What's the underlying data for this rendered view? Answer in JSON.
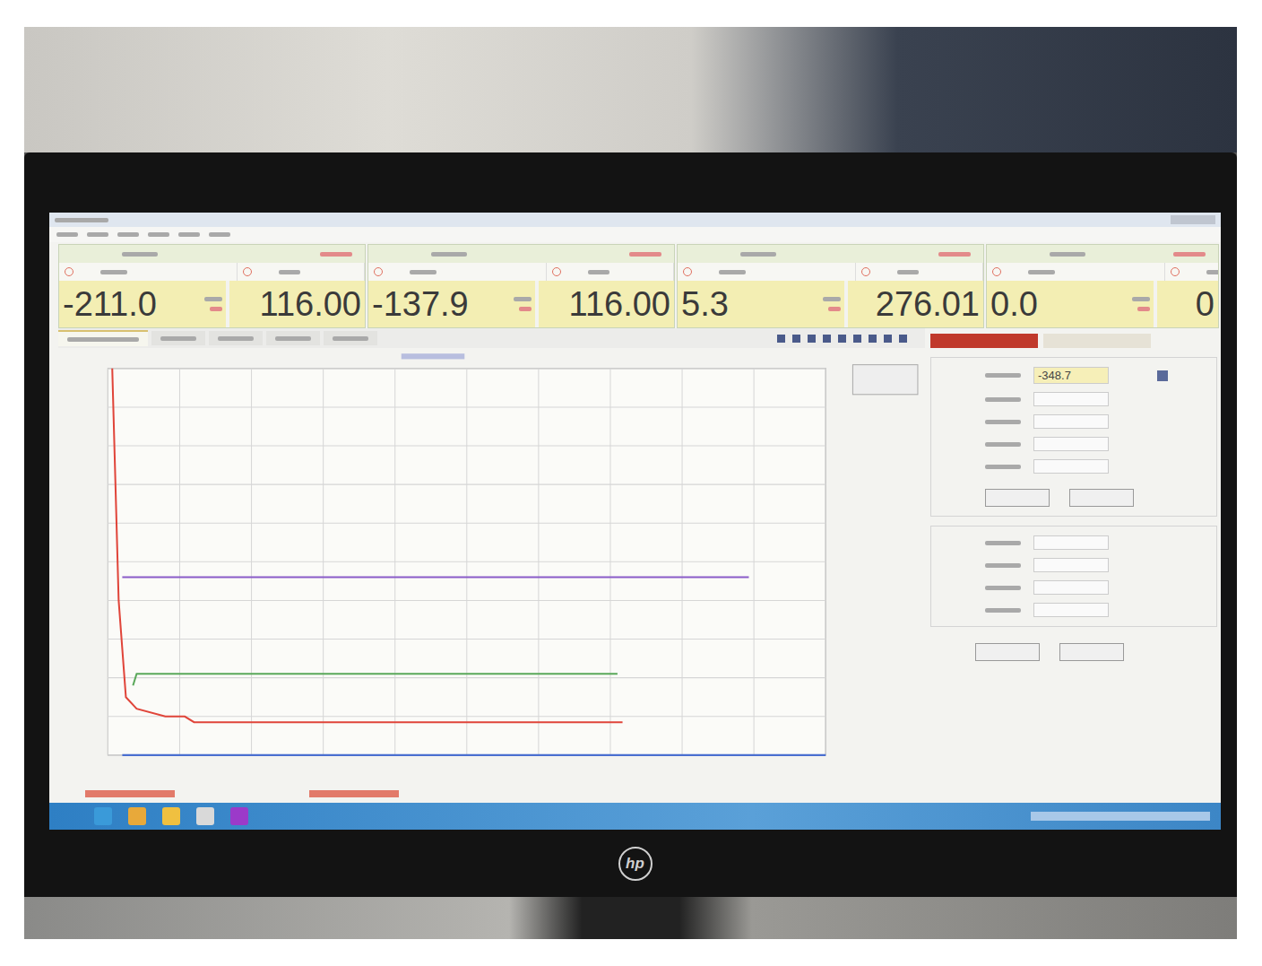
{
  "readouts": [
    {
      "value": "-211.0",
      "secondary": "116.00"
    },
    {
      "value": "-137.9",
      "secondary": "116.00"
    },
    {
      "value": "5.3",
      "secondary": "276.01"
    },
    {
      "value": "0.0",
      "secondary": "0"
    }
  ],
  "chart": {
    "series": [
      {
        "color": "#e0453a",
        "x": [
          0.6,
          1.5,
          2.5,
          4,
          8,
          10.7,
          12,
          71.7
        ],
        "values": [
          100,
          40,
          15,
          12,
          10,
          10,
          8.5,
          8.5
        ]
      },
      {
        "color": "#5aa85a",
        "x": [
          3.5,
          4,
          10,
          71
        ],
        "values": [
          18,
          21,
          21,
          21
        ]
      },
      {
        "color": "#8a5cc8",
        "x": [
          2,
          89.3
        ],
        "values": [
          46,
          46
        ]
      },
      {
        "color": "#4a6fd0",
        "x": [
          2,
          100
        ],
        "values": [
          0,
          0
        ]
      }
    ]
  },
  "side_panel": {
    "reading": "-348.7"
  },
  "monitor": {
    "brand": "hp"
  }
}
